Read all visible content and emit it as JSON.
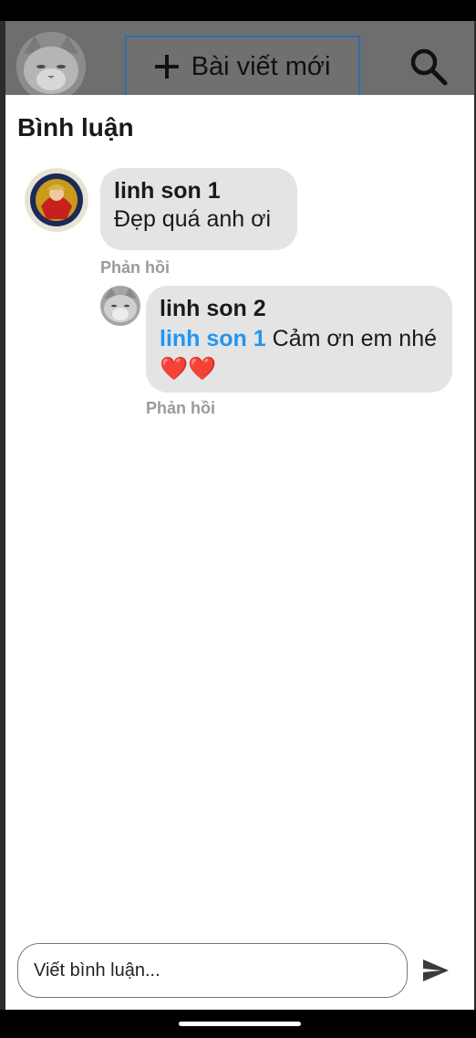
{
  "header": {
    "new_post_label": "Bài viết mới",
    "icons": {
      "add": "plus-icon",
      "search": "search-icon"
    }
  },
  "comments_sheet": {
    "title": "Bình luận",
    "comments": [
      {
        "author": "linh son 1",
        "text": "Đẹp quá anh ơi",
        "reply_label": "Phản hồi",
        "replies": [
          {
            "author": "linh son 2",
            "mention": "linh son 1",
            "text": "Cảm ơn em nhé ❤️❤️",
            "reply_label": "Phản hồi"
          }
        ]
      }
    ]
  },
  "composer": {
    "placeholder": "Viết bình luận...",
    "send_icon": "send-icon"
  },
  "colors": {
    "mention": "#2196f3",
    "bubble": "#e4e4e4",
    "header_overlay": "#6e6e6e",
    "button_border": "#2f6db0"
  }
}
